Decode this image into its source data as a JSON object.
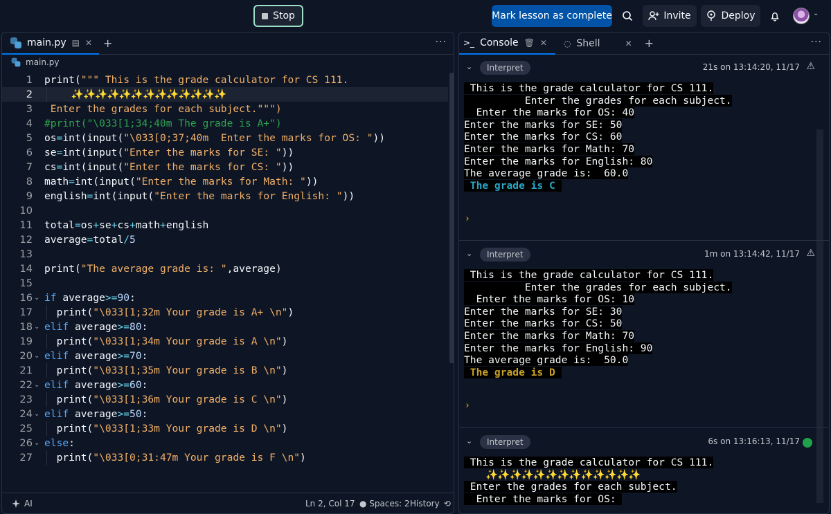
{
  "topbar": {
    "stop_label": "Stop",
    "mark_complete_label": "Mark lesson as complete",
    "invite_label": "Invite",
    "deploy_label": "Deploy"
  },
  "editor": {
    "tab_label": "main.py",
    "breadcrumb": "main.py",
    "lines": [
      {
        "n": "1",
        "text": "print(\"\"\" This is the grade calculator for CS 111."
      },
      {
        "n": "2",
        "text": "     ✨✨✨✨✨✨✨✨✨✨✨✨✨"
      },
      {
        "n": "3",
        "text": " Enter the grades for each subject.\"\"\")"
      },
      {
        "n": "4",
        "text": "#print(\"\\033[1;34;40m The grade is A+\")"
      },
      {
        "n": "5",
        "text": "os=int(input(\"\\033[0;37;40m  Enter the marks for OS: \"))"
      },
      {
        "n": "6",
        "text": "se=int(input(\"Enter the marks for SE: \"))"
      },
      {
        "n": "7",
        "text": "cs=int(input(\"Enter the marks for CS: \"))"
      },
      {
        "n": "8",
        "text": "math=int(input(\"Enter the marks for Math: \"))"
      },
      {
        "n": "9",
        "text": "english=int(input(\"Enter the marks for English: \"))"
      },
      {
        "n": "10",
        "text": ""
      },
      {
        "n": "11",
        "text": "total=os+se+cs+math+english"
      },
      {
        "n": "12",
        "text": "average=total/5"
      },
      {
        "n": "13",
        "text": ""
      },
      {
        "n": "14",
        "text": "print(\"The average grade is: \",average)"
      },
      {
        "n": "15",
        "text": ""
      },
      {
        "n": "16",
        "text": "if average>=90:"
      },
      {
        "n": "17",
        "text": "  print(\"\\033[1;32m Your grade is A+ \\n\")"
      },
      {
        "n": "18",
        "text": "elif average>=80:"
      },
      {
        "n": "19",
        "text": "  print(\"\\033[1;34m Your grade is A \\n\")"
      },
      {
        "n": "20",
        "text": "elif average>=70:"
      },
      {
        "n": "21",
        "text": "  print(\"\\033[1;35m Your grade is B \\n\")"
      },
      {
        "n": "22",
        "text": "elif average>=60:"
      },
      {
        "n": "23",
        "text": "  print(\"\\033[1;36m Your grade is C \\n\")"
      },
      {
        "n": "24",
        "text": "elif average>=50:"
      },
      {
        "n": "25",
        "text": "  print(\"\\033[1;33m Your grade is D \\n\")"
      },
      {
        "n": "26",
        "text": "else:"
      },
      {
        "n": "27",
        "text": "  print(\"\\033[0;31:47m Your grade is F \\n\")"
      }
    ]
  },
  "status": {
    "ai_label": "AI",
    "position": "Ln 2, Col 17",
    "spaces": "Spaces: 2",
    "history_label": "History"
  },
  "console": {
    "tab_console": "Console",
    "tab_shell": "Shell",
    "runs": [
      {
        "badge": "Interpret",
        "time": "21s on 13:14:20, 11/17",
        "status": "warning",
        "output": [
          " This is the grade calculator for CS 111.",
          "",
          "          Enter the grades for each subject.",
          "  Enter the marks for OS: 40",
          "Enter the marks for SE: 50",
          "Enter the marks for CS: 60",
          "Enter the marks for Math: 70",
          "Enter the marks for English: 80",
          "The average grade is:  60.0"
        ],
        "grade": " The grade is C ",
        "grade_color": "#2aa8c9"
      },
      {
        "badge": "Interpret",
        "time": "1m on 13:14:42, 11/17",
        "status": "warning",
        "output": [
          " This is the grade calculator for CS 111.",
          "",
          "          Enter the grades for each subject.",
          "  Enter the marks for OS: 10",
          "Enter the marks for SE: 30",
          "Enter the marks for CS: 50",
          "Enter the marks for Math: 70",
          "Enter the marks for English: 90",
          "The average grade is:  50.0"
        ],
        "grade": " The grade is D ",
        "grade_color": "#c9a227"
      },
      {
        "badge": "Interpret",
        "time": "6s on 13:16:13, 11/17",
        "status": "running",
        "output": [
          " This is the grade calculator for CS 111.",
          "    ✨✨✨✨✨✨✨✨✨✨✨✨✨",
          " Enter the grades for each subject.",
          "  Enter the marks for OS: "
        ]
      }
    ]
  },
  "icons": {
    "prompt_glyph": "›"
  }
}
